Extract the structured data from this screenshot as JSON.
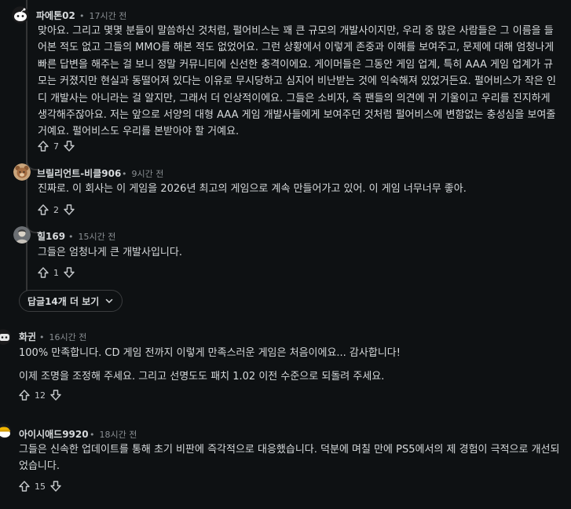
{
  "comments": [
    {
      "username": "파에톤02",
      "time": "17시간 전",
      "paragraphs": [
        "맞아요. 그리고 몇몇 분들이 말씀하신 것처럼, 펄어비스는 꽤 큰 규모의 개발사이지만, 우리 중 많은 사람들은 그 이름을 들어본 적도 없고 그들의 MMO를 해본 적도 없었어요. 그런 상황에서 이렇게 존중과 이해를 보여주고, 문제에 대해 엄청나게 빠른 답변을 해주는 걸 보니 정말 커뮤니티에 신선한 충격이에요. 게이머들은 그동안 게임 업계, 특히 AAA 게임 업계가 규모는 커졌지만 현실과 동떨어져 있다는 이유로 무시당하고 심지어 비난받는 것에 익숙해져 있었거든요. 펄어비스가 작은 인디 개발사는 아니라는 걸 알지만, 그래서 더 인상적이에요. 그들은 소비자, 즉 팬들의 의견에 귀 기울이고 우리를 진지하게 생각해주잖아요. 저는 앞으로 서양의 대형 AAA 게임 개발사들에게 보여주던 것처럼 펄어비스에 변함없는 충성심을 보여줄 거예요. 펄어비스도 우리를 본받아야 할 거예요."
      ],
      "score": "7"
    },
    {
      "username": "브릴리언트-비클906",
      "time": "9시간 전",
      "paragraphs": [
        "진짜로. 이 회사는 이 게임을 2026년 최고의 게임으로 계속 만들어가고 있어. 이 게임 너무너무 좋아."
      ],
      "score": "2"
    },
    {
      "username": "힐169",
      "time": "15시간 전",
      "paragraphs": [
        "그들은 엄청나게 큰 개발사입니다."
      ],
      "score": "1"
    },
    {
      "username": "화귄",
      "time": "16시간 전",
      "paragraphs": [
        "100% 만족합니다. CD 게임 전까지 이렇게 만족스러운 게임은 처음이에요... 감사합니다!",
        "이제 조명을 조정해 주세요. 그리고 선명도도 패치 1.02 이전 수준으로 되돌려 주세요."
      ],
      "score": "12"
    },
    {
      "username": "아이시애드9920",
      "time": "18시간 전",
      "paragraphs": [
        "그들은 신속한 업데이트를 통해 초기 비판에 즉각적으로 대응했습니다. 덕분에 며칠 만에 PS5에서의 제 경험이 극적으로 개선되었습니다."
      ],
      "score": "15"
    }
  ],
  "more_replies": {
    "label": "답글14개 더 보기"
  },
  "colors": {
    "background": "#0e1113",
    "text": "#d7dadc",
    "meta": "#8a8f93",
    "rail": "#343536"
  },
  "icons": [
    "upvote-icon",
    "downvote-icon",
    "chevron-down-icon"
  ]
}
